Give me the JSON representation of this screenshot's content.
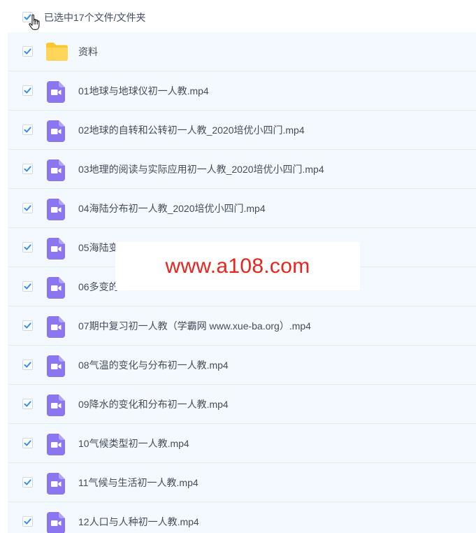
{
  "header": {
    "selection_label": "已选中17个文件/文件夹"
  },
  "files": [
    {
      "type": "folder",
      "icon": "folder-icon",
      "name": "资料"
    },
    {
      "type": "video",
      "icon": "video-file-icon",
      "name": "01地球与地球仪初一人教.mp4"
    },
    {
      "type": "video",
      "icon": "video-file-icon",
      "name": "02地球的自转和公转初一人教_2020培优小四门.mp4"
    },
    {
      "type": "video",
      "icon": "video-file-icon",
      "name": "03地理的阅读与实际应用初一人教_2020培优小四门.mp4"
    },
    {
      "type": "video",
      "icon": "video-file-icon",
      "name": "04海陆分布初一人教_2020培优小四门.mp4"
    },
    {
      "type": "video",
      "icon": "video-file-icon",
      "name": "05海陆变"
    },
    {
      "type": "video",
      "icon": "video-file-icon",
      "name": "06多变的"
    },
    {
      "type": "video",
      "icon": "video-file-icon",
      "name": "07期中复习初一人教（学霸网 www.xue-ba.org）.mp4"
    },
    {
      "type": "video",
      "icon": "video-file-icon",
      "name": "08气温的变化与分布初一人教.mp4"
    },
    {
      "type": "video",
      "icon": "video-file-icon",
      "name": "09降水的变化和分布初一人教.mp4"
    },
    {
      "type": "video",
      "icon": "video-file-icon",
      "name": "10气候类型初一人教.mp4"
    },
    {
      "type": "video",
      "icon": "video-file-icon",
      "name": "11气候与生活初一人教.mp4"
    },
    {
      "type": "video",
      "icon": "video-file-icon",
      "name": "12人口与人种初一人教.mp4"
    }
  ],
  "watermark": {
    "text": "www.a108.com"
  },
  "colors": {
    "accent": "#2f8df3",
    "list_background": "#f3f9ff",
    "folder": "#ffcd3c",
    "video": "#8c76f0",
    "watermark_text": "#e8241d"
  }
}
